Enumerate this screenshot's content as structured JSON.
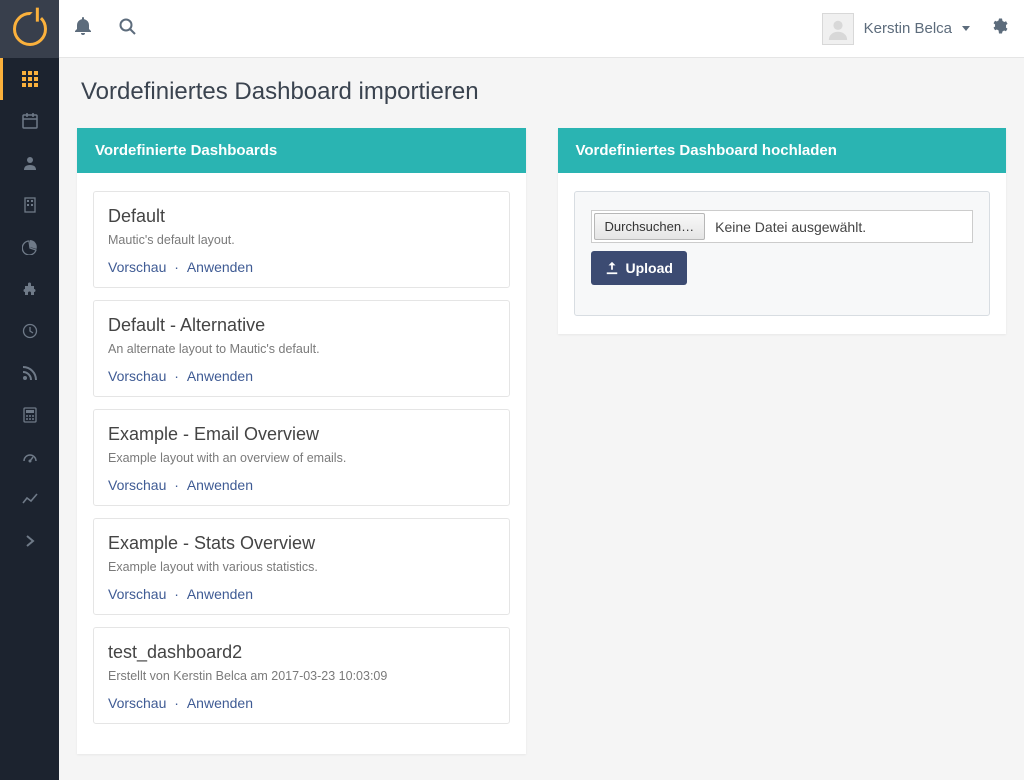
{
  "topbar": {
    "user_name": "Kerstin Belca"
  },
  "page": {
    "title": "Vordefiniertes Dashboard importieren"
  },
  "panels": {
    "list_header": "Vordefinierte Dashboards",
    "upload_header": "Vordefiniertes Dashboard hochladen"
  },
  "dashboards": [
    {
      "title": "Default",
      "desc": "Mautic's default layout.",
      "preview": "Vorschau",
      "apply": "Anwenden"
    },
    {
      "title": "Default - Alternative",
      "desc": "An alternate layout to Mautic's default.",
      "preview": "Vorschau",
      "apply": "Anwenden"
    },
    {
      "title": "Example - Email Overview",
      "desc": "Example layout with an overview of emails.",
      "preview": "Vorschau",
      "apply": "Anwenden"
    },
    {
      "title": "Example - Stats Overview",
      "desc": "Example layout with various statistics.",
      "preview": "Vorschau",
      "apply": "Anwenden"
    },
    {
      "title": "test_dashboard2",
      "desc": "Erstellt von Kerstin Belca am 2017-03-23 10:03:09",
      "preview": "Vorschau",
      "apply": "Anwenden"
    }
  ],
  "upload": {
    "browse_label": "Durchsuchen…",
    "no_file": "Keine Datei ausgewählt.",
    "button": "Upload"
  },
  "sidebar": {
    "items": [
      {
        "name": "dashboard",
        "active": true
      },
      {
        "name": "calendar",
        "active": false
      },
      {
        "name": "contacts",
        "active": false
      },
      {
        "name": "companies",
        "active": false
      },
      {
        "name": "segments",
        "active": false
      },
      {
        "name": "components",
        "active": false
      },
      {
        "name": "stages",
        "active": false
      },
      {
        "name": "channels",
        "active": false
      },
      {
        "name": "points",
        "active": false
      },
      {
        "name": "campaigns",
        "active": false
      },
      {
        "name": "reports",
        "active": false
      },
      {
        "name": "expand",
        "active": false
      }
    ]
  }
}
